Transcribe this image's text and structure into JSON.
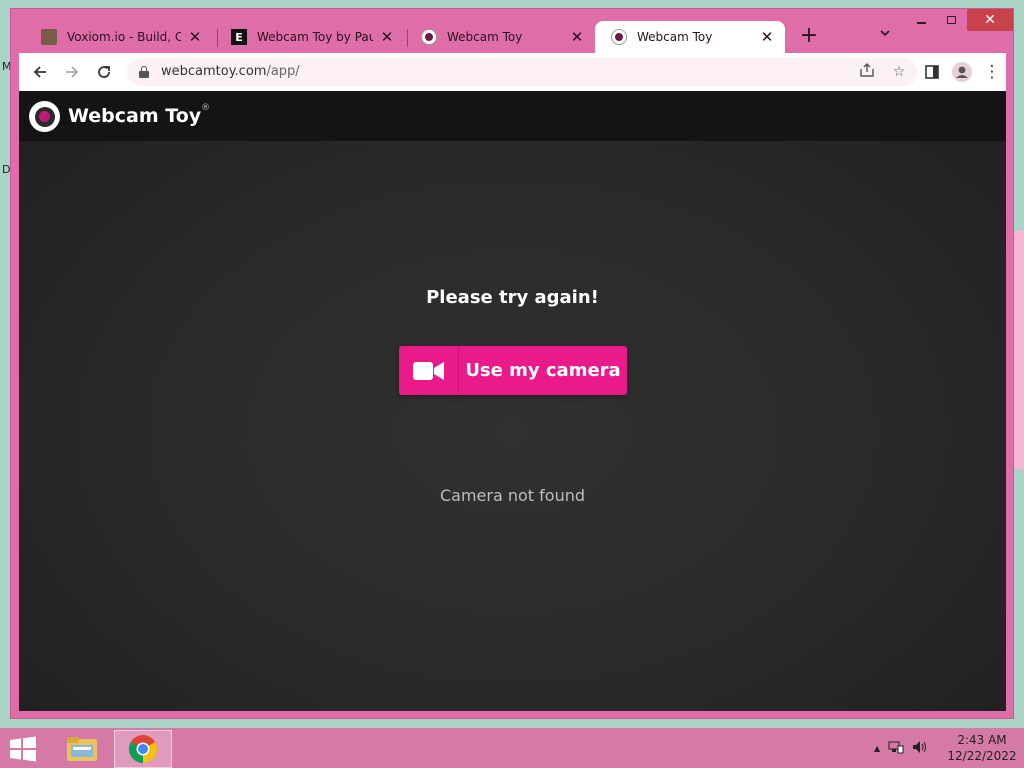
{
  "desktop": {
    "left_letters": [
      "M",
      "D"
    ]
  },
  "browser": {
    "tabs": [
      {
        "title": "Voxiom.io - Build, Craft",
        "favicon": "voxiom-icon",
        "active": false
      },
      {
        "title": "Webcam Toy by Paul Ne",
        "favicon": "letter-e-icon",
        "active": false
      },
      {
        "title": "Webcam Toy",
        "favicon": "webcamtoy-icon",
        "active": false
      },
      {
        "title": "Webcam Toy",
        "favicon": "webcamtoy-icon",
        "active": true
      }
    ],
    "new_tab_symbol": "+",
    "tab_close_symbol": "✕",
    "tab_list_symbol": "⌄",
    "window_controls": {
      "close_symbol": "✕"
    },
    "address": {
      "host": "webcamtoy.com",
      "path": "/app/"
    },
    "nav": {
      "back_symbol": "←",
      "forward_symbol": "→",
      "reload_symbol": "↻",
      "share_symbol": "⇪",
      "star_symbol": "☆",
      "menu_symbol": "⋮"
    }
  },
  "page": {
    "site_name": "Webcam Toy",
    "registered_mark": "®",
    "prompt": "Please try again!",
    "camera_button_label": "Use my camera",
    "status_message": "Camera not found",
    "accent_color": "#ea1a8b"
  },
  "taskbar": {
    "time": "2:43 AM",
    "date": "12/22/2022",
    "tray_expand_symbol": "▲"
  }
}
